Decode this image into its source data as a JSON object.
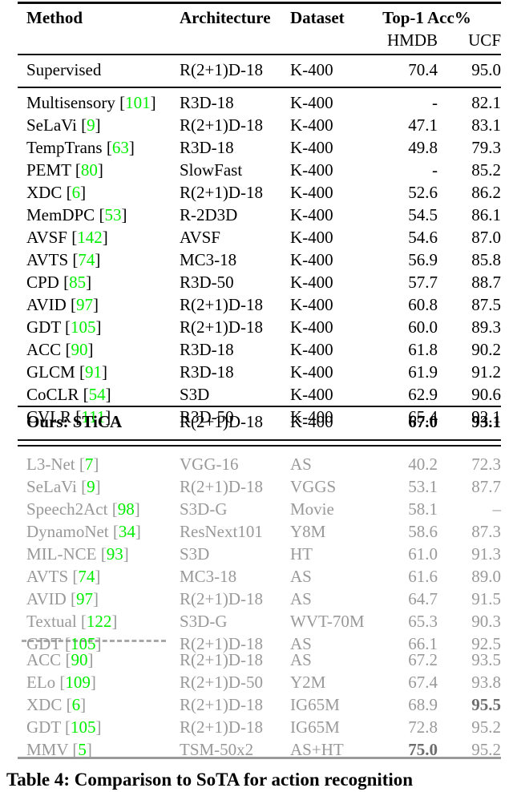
{
  "table": {
    "columns": {
      "method": "Method",
      "architecture": "Architecture",
      "dataset": "Dataset",
      "accuracy_group": "Top-1 Acc%",
      "hmdb": "HMDB",
      "ucf": "UCF"
    },
    "supervised_section": [
      {
        "method": "Supervised",
        "cite": "",
        "architecture": "R(2+1)D-18",
        "dataset": "K-400",
        "hmdb": "70.4",
        "ucf": "95.0"
      }
    ],
    "k400_section": [
      {
        "method": "Multisensory",
        "cite": "101",
        "architecture": "R3D-18",
        "dataset": "K-400",
        "hmdb": "-",
        "ucf": "82.1"
      },
      {
        "method": "SeLaVi",
        "cite": "9",
        "architecture": "R(2+1)D-18",
        "dataset": "K-400",
        "hmdb": "47.1",
        "ucf": "83.1"
      },
      {
        "method": "TempTrans",
        "cite": "63",
        "architecture": "R3D-18",
        "dataset": "K-400",
        "hmdb": "49.8",
        "ucf": "79.3"
      },
      {
        "method": "PEMT",
        "cite": "80",
        "architecture": "SlowFast",
        "dataset": "K-400",
        "hmdb": "-",
        "ucf": "85.2"
      },
      {
        "method": "XDC",
        "cite": "6",
        "architecture": "R(2+1)D-18",
        "dataset": "K-400",
        "hmdb": "52.6",
        "ucf": "86.2"
      },
      {
        "method": "MemDPC",
        "cite": "53",
        "architecture": "R-2D3D",
        "dataset": "K-400",
        "hmdb": "54.5",
        "ucf": "86.1"
      },
      {
        "method": "AVSF",
        "cite": "142",
        "architecture": "AVSF",
        "dataset": "K-400",
        "hmdb": "54.6",
        "ucf": "87.0"
      },
      {
        "method": "AVTS",
        "cite": "74",
        "architecture": "MC3-18",
        "dataset": "K-400",
        "hmdb": "56.9",
        "ucf": "85.8"
      },
      {
        "method": "CPD",
        "cite": "85",
        "architecture": "R3D-50",
        "dataset": "K-400",
        "hmdb": "57.7",
        "ucf": "88.7"
      },
      {
        "method": "AVID",
        "cite": "97",
        "architecture": "R(2+1)D-18",
        "dataset": "K-400",
        "hmdb": "60.8",
        "ucf": "87.5"
      },
      {
        "method": "GDT",
        "cite": "105",
        "architecture": "R(2+1)D-18",
        "dataset": "K-400",
        "hmdb": "60.0",
        "ucf": "89.3"
      },
      {
        "method": "ACC",
        "cite": "90",
        "architecture": "R3D-18",
        "dataset": "K-400",
        "hmdb": "61.8",
        "ucf": "90.2"
      },
      {
        "method": "GLCM",
        "cite": "91",
        "architecture": "R3D-18",
        "dataset": "K-400",
        "hmdb": "61.9",
        "ucf": "91.2"
      },
      {
        "method": "CoCLR",
        "cite": "54",
        "architecture": "S3D",
        "dataset": "K-400",
        "hmdb": "62.9",
        "ucf": "90.6"
      },
      {
        "method": "CVLR",
        "cite": "111",
        "architecture": "R3D-50",
        "dataset": "K-400",
        "hmdb": "65.4",
        "ucf": "92.1"
      }
    ],
    "ours_section": [
      {
        "method": "Ours: STiCA",
        "cite": "",
        "architecture": "R(2+1)D-18",
        "dataset": "K-400",
        "hmdb": "67.0",
        "ucf": "93.1"
      }
    ],
    "other_section_top": [
      {
        "method": "L3-Net",
        "cite": "7",
        "architecture": "VGG-16",
        "dataset": "AS",
        "hmdb": "40.2",
        "ucf": "72.3"
      },
      {
        "method": "SeLaVi",
        "cite": "9",
        "architecture": "R(2+1)D-18",
        "dataset": "VGGS",
        "hmdb": "53.1",
        "ucf": "87.7"
      },
      {
        "method": "Speech2Act",
        "cite": "98",
        "architecture": "S3D-G",
        "dataset": "Movie",
        "hmdb": "58.1",
        "ucf": "–"
      },
      {
        "method": "DynamoNet",
        "cite": "34",
        "architecture": "ResNext101",
        "dataset": "Y8M",
        "hmdb": "58.6",
        "ucf": "87.3"
      },
      {
        "method": "MIL-NCE",
        "cite": "93",
        "architecture": "S3D",
        "dataset": "HT",
        "hmdb": "61.0",
        "ucf": "91.3"
      },
      {
        "method": "AVTS",
        "cite": "74",
        "architecture": "MC3-18",
        "dataset": "AS",
        "hmdb": "61.6",
        "ucf": "89.0"
      },
      {
        "method": "AVID",
        "cite": "97",
        "architecture": "R(2+1)D-18",
        "dataset": "AS",
        "hmdb": "64.7",
        "ucf": "91.5"
      },
      {
        "method": "Textual",
        "cite": "122",
        "architecture": "S3D-G",
        "dataset": "WVT-70M",
        "hmdb": "65.3",
        "ucf": "90.3"
      },
      {
        "method": "GDT",
        "cite": "105",
        "architecture": "R(2+1)D-18",
        "dataset": "AS",
        "hmdb": "66.1",
        "ucf": "92.5"
      }
    ],
    "other_section_bottom": [
      {
        "method": "ACC",
        "cite": "90",
        "architecture": "R(2+1)D-18",
        "dataset": "AS",
        "hmdb": "67.2",
        "ucf": "93.5"
      },
      {
        "method": "ELo",
        "cite": "109",
        "architecture": "R(2+1)D-50",
        "dataset": "Y2M",
        "hmdb": "67.4",
        "ucf": "93.8"
      },
      {
        "method": "XDC",
        "cite": "6",
        "architecture": "R(2+1)D-18",
        "dataset": "IG65M",
        "hmdb": "68.9",
        "ucf": "95.5"
      },
      {
        "method": "GDT",
        "cite": "105",
        "architecture": "R(2+1)D-18",
        "dataset": "IG65M",
        "hmdb": "72.8",
        "ucf": "95.2"
      },
      {
        "method": "MMV",
        "cite": "5",
        "architecture": "TSM-50x2",
        "dataset": "AS+HT",
        "hmdb": "75.0",
        "ucf": "95.2"
      }
    ]
  },
  "caption": {
    "text": "Table 4:  Comparison to SoTA for action recognition"
  },
  "colors": {
    "citation_green": "#00ee00",
    "gray_text": "#999999",
    "rule_black": "#0d0d0d",
    "rule_gray": "#9a9a9a"
  }
}
